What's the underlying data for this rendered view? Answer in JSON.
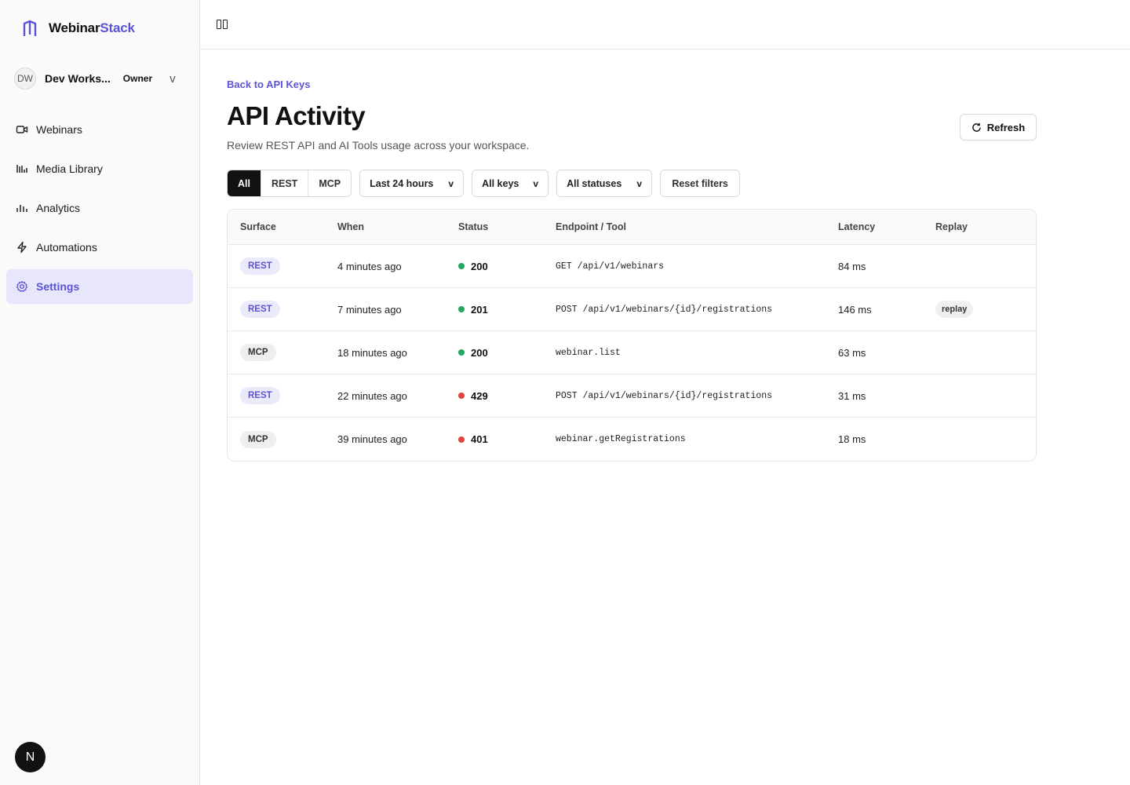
{
  "brand": {
    "name_part1": "Webinar",
    "name_part2": "Stack",
    "accent_color": "#5b55d6"
  },
  "workspace": {
    "initials": "DW",
    "name": "Dev Works...",
    "role": "Owner",
    "chevron": "v"
  },
  "nav": {
    "items": [
      {
        "label": "Webinars",
        "icon": "video-icon",
        "active": false
      },
      {
        "label": "Media Library",
        "icon": "media-library-icon",
        "active": false
      },
      {
        "label": "Analytics",
        "icon": "bar-chart-icon",
        "active": false
      },
      {
        "label": "Automations",
        "icon": "lightning-icon",
        "active": false
      },
      {
        "label": "Settings",
        "icon": "gear-icon",
        "active": true
      }
    ]
  },
  "user": {
    "initial": "N"
  },
  "header": {
    "back_link": "Back to API Keys",
    "title": "API Activity",
    "subtitle": "Review REST API and AI Tools usage across your workspace.",
    "refresh_label": "Refresh"
  },
  "filters": {
    "surface_tabs": [
      {
        "label": "All",
        "active": true
      },
      {
        "label": "REST",
        "active": false
      },
      {
        "label": "MCP",
        "active": false
      }
    ],
    "time_range": "Last 24 hours",
    "keys": "All keys",
    "statuses": "All statuses",
    "chevron": "v",
    "reset_label": "Reset filters"
  },
  "table": {
    "columns": [
      "Surface",
      "When",
      "Status",
      "Endpoint / Tool",
      "Latency",
      "Replay"
    ],
    "rows": [
      {
        "surface": "REST",
        "when": "4 minutes ago",
        "status": "200",
        "status_color": "#22a861",
        "endpoint": "GET /api/v1/webinars",
        "latency": "84 ms",
        "replay": ""
      },
      {
        "surface": "REST",
        "when": "7 minutes ago",
        "status": "201",
        "status_color": "#22a861",
        "endpoint": "POST /api/v1/webinars/{id}/registrations",
        "latency": "146 ms",
        "replay": "replay"
      },
      {
        "surface": "MCP",
        "when": "18 minutes ago",
        "status": "200",
        "status_color": "#22a861",
        "endpoint": "webinar.list",
        "latency": "63 ms",
        "replay": ""
      },
      {
        "surface": "REST",
        "when": "22 minutes ago",
        "status": "429",
        "status_color": "#e0443a",
        "endpoint": "POST /api/v1/webinars/{id}/registrations",
        "latency": "31 ms",
        "replay": ""
      },
      {
        "surface": "MCP",
        "when": "39 minutes ago",
        "status": "401",
        "status_color": "#e0443a",
        "endpoint": "webinar.getRegistrations",
        "latency": "18 ms",
        "replay": ""
      }
    ]
  }
}
